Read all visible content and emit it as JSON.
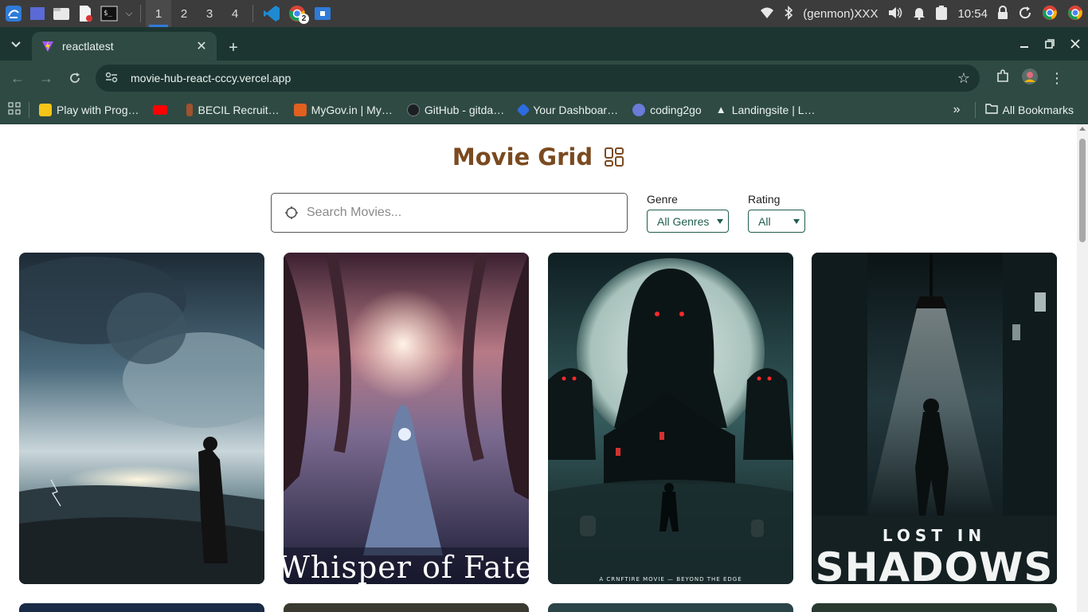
{
  "taskbar": {
    "workspaces": [
      "1",
      "2",
      "3",
      "4"
    ],
    "active_workspace": "1",
    "chrome_badge": "2",
    "network_label": "(genmon)XXX",
    "clock": "10:54",
    "icons": [
      "app-menu-icon",
      "desktop-icon",
      "file-manager-icon",
      "text-editor-icon",
      "terminal-icon",
      "vscode-icon",
      "chrome-icon",
      "app-window-icon",
      "wifi-icon",
      "bluetooth-icon",
      "volume-icon",
      "bell-icon",
      "battery-icon",
      "lock-icon",
      "refresh-icon",
      "chrome-icon"
    ]
  },
  "browser": {
    "tab_title": "reactlatest",
    "url": "movie-hub-react-cccy.vercel.app",
    "bookmarks": [
      {
        "label": "Play with Prog…",
        "color": "#f5c518"
      },
      {
        "label": "",
        "color": "#ff0000"
      },
      {
        "label": "BECIL Recruit…",
        "color": "#a0522d"
      },
      {
        "label": "MyGov.in | My…",
        "color": "#e06020"
      },
      {
        "label": "GitHub - gitda…",
        "color": "#1b1f23"
      },
      {
        "label": "Your Dashboar…",
        "color": "#2d6cdf"
      },
      {
        "label": "coding2go",
        "color": "#6a7bd8"
      },
      {
        "label": "Landingsite | L…",
        "color": "#e9f1ee"
      }
    ],
    "all_bookmarks": "All Bookmarks"
  },
  "page": {
    "title": "Movie Grid",
    "search": {
      "placeholder": "Search Movies..."
    },
    "genre": {
      "label": "Genre",
      "selected": "All Genres"
    },
    "rating": {
      "label": "Rating",
      "selected": "All"
    },
    "posters": [
      {
        "name": "poster-storm",
        "text": ""
      },
      {
        "name": "poster-whisper-of-fate",
        "text": "Whisper of Fate"
      },
      {
        "name": "poster-haunted-house",
        "text": "A CRNFTIRE MOVIE — BEYOND THE EDGE"
      },
      {
        "name": "poster-lost-in-shadows",
        "text_top": "LOST IN",
        "text_bottom": "SHADOWS"
      }
    ]
  }
}
